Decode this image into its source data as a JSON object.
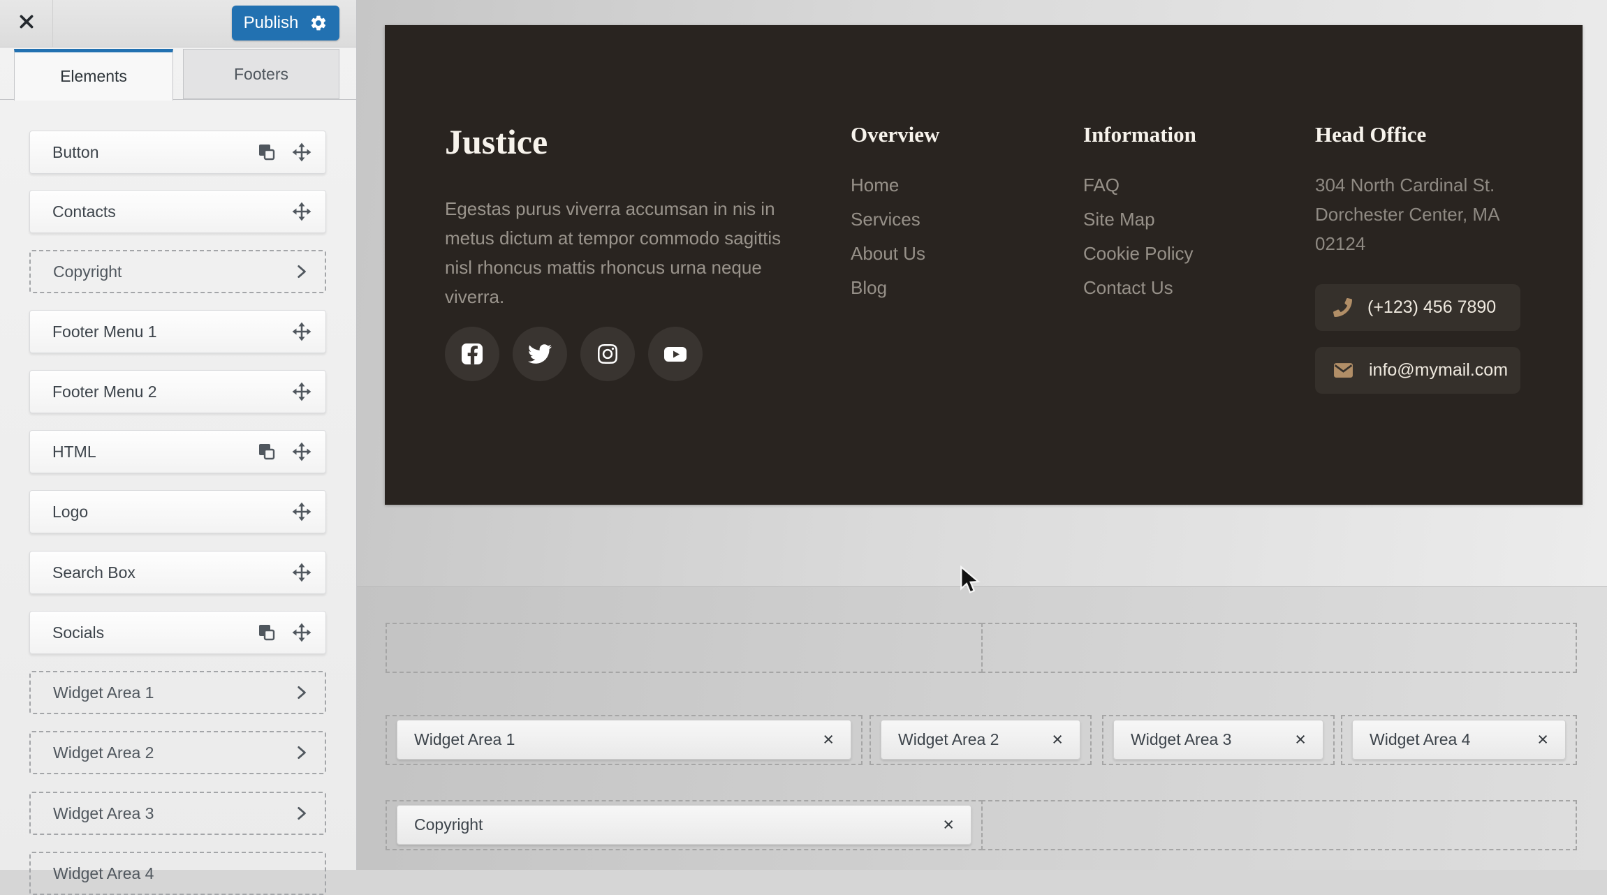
{
  "colors": {
    "accent": "#2271b1",
    "footer_bg": "#292420",
    "footer_heading": "#f7f3ec",
    "footer_text": "#9a948c",
    "contact_icon": "#b18e67"
  },
  "panel": {
    "publish_label": "Publish",
    "tabs": {
      "elements": "Elements",
      "footers": "Footers"
    },
    "elements": [
      {
        "label": "Button",
        "type": "solid",
        "icons": [
          "duplicate",
          "move"
        ]
      },
      {
        "label": "Contacts",
        "type": "solid",
        "icons": [
          "move"
        ]
      },
      {
        "label": "Copyright",
        "type": "dashed",
        "icons": [
          "chevron"
        ]
      },
      {
        "label": "Footer Menu 1",
        "type": "solid",
        "icons": [
          "move"
        ]
      },
      {
        "label": "Footer Menu 2",
        "type": "solid",
        "icons": [
          "move"
        ]
      },
      {
        "label": "HTML",
        "type": "solid",
        "icons": [
          "duplicate",
          "move"
        ]
      },
      {
        "label": "Logo",
        "type": "solid",
        "icons": [
          "move"
        ]
      },
      {
        "label": "Search Box",
        "type": "solid",
        "icons": [
          "move"
        ]
      },
      {
        "label": "Socials",
        "type": "solid",
        "icons": [
          "duplicate",
          "move"
        ]
      },
      {
        "label": "Widget Area 1",
        "type": "dashed",
        "icons": [
          "chevron"
        ]
      },
      {
        "label": "Widget Area 2",
        "type": "dashed",
        "icons": [
          "chevron"
        ]
      },
      {
        "label": "Widget Area 3",
        "type": "dashed",
        "icons": [
          "chevron"
        ]
      },
      {
        "label": "Widget Area 4",
        "type": "dashed",
        "icons": [
          "chevron"
        ]
      }
    ]
  },
  "preview": {
    "brand_title": "Justice",
    "brand_description": "Egestas purus viverra accumsan in nis in metus dictum at tempor commodo sagittis nisl rhoncus mattis rhoncus urna neque viverra.",
    "social_icons": [
      "facebook",
      "twitter",
      "instagram",
      "youtube"
    ],
    "menu1": {
      "title": "Overview",
      "items": [
        "Home",
        "Services",
        "About Us",
        "Blog"
      ]
    },
    "menu2": {
      "title": "Information",
      "items": [
        "FAQ",
        "Site Map",
        "Cookie Policy",
        "Contact Us"
      ]
    },
    "office": {
      "title": "Head Office",
      "address_lines": [
        "304 North Cardinal St.",
        "Dorchester Center, MA",
        "02124"
      ],
      "phone": "(+123) 456 7890",
      "email": "info@mymail.com"
    }
  },
  "builder": {
    "widget_chips": [
      "Widget Area 1",
      "Widget Area 2",
      "Widget Area 3",
      "Widget Area 4"
    ],
    "copyright_chip": "Copyright"
  }
}
